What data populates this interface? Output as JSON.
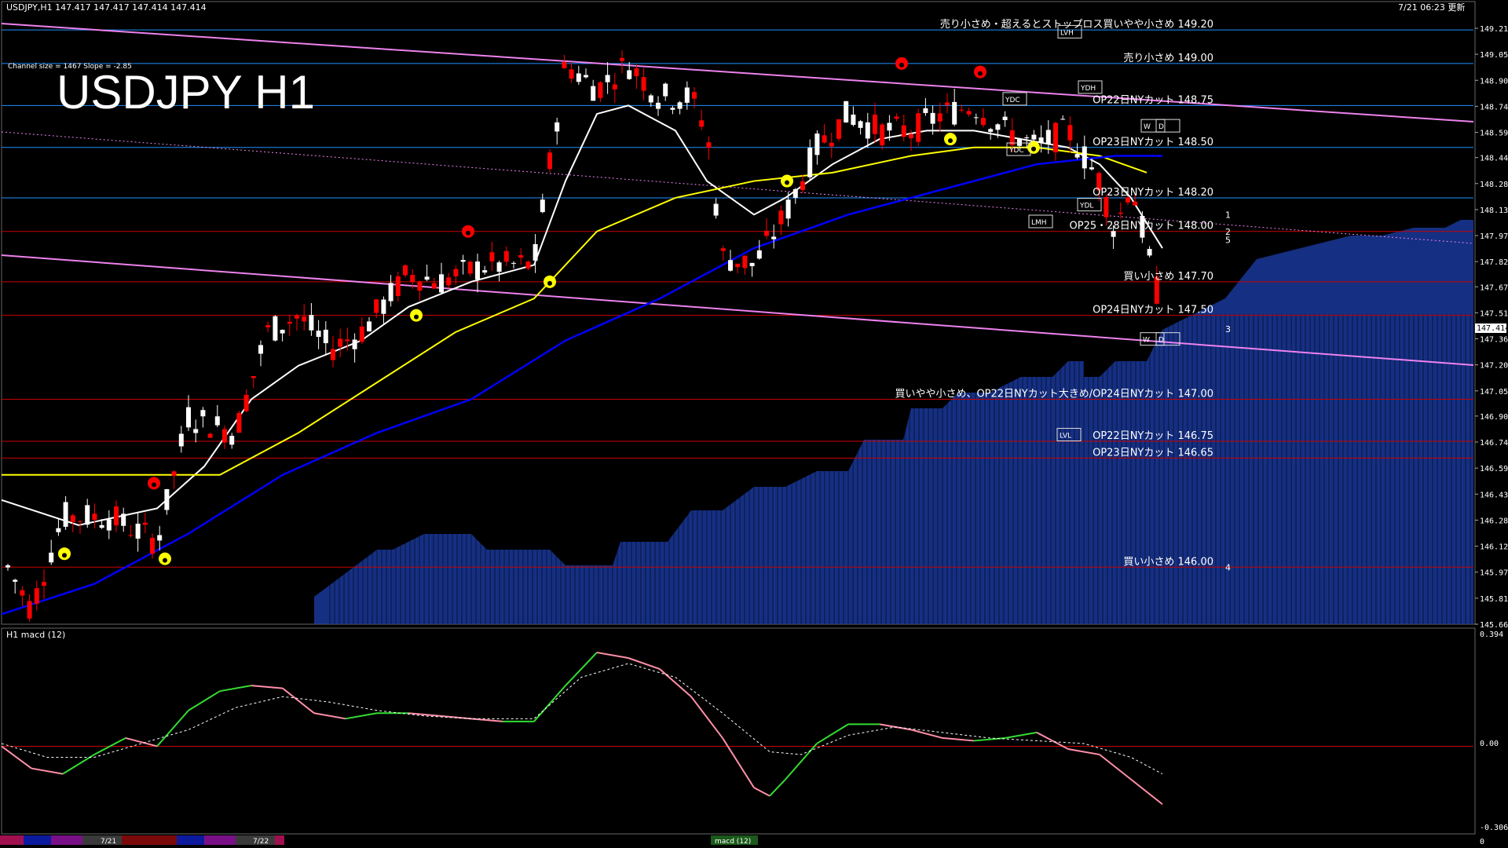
{
  "header": {
    "symbol_line": "USDJPY,H1  147.417 147.417 147.414 147.414",
    "channel_info": "Channel size = 1467 Slope = -2.85",
    "timestamp": "7/21 06:23 更新",
    "title": "USDJPY H1"
  },
  "macd_panel": {
    "label": "H1  macd (12)",
    "axis": [
      "0.394",
      "0.00",
      "-0.306",
      "0"
    ]
  },
  "bottom_bar": {
    "dates": [
      "7/21",
      "7/22"
    ],
    "indicator": "macd (12)"
  },
  "colors": {
    "bg": "#000000",
    "bull_candle": "#ffffff",
    "bear_candle": "#ff0000",
    "level_red": "#cc0000",
    "level_blue": "#1e90ff",
    "channel": "#ee82ee",
    "ma_white": "#ffffff",
    "ma_yellow": "#ffff00",
    "ma_blue": "#0000ff",
    "cloud": "#1c3fae",
    "macd_main_up": "#33dd33",
    "macd_main_down": "#ff8fa8",
    "macd_signal": "#ffffff"
  },
  "chart_data": {
    "type": "candlestick",
    "symbol": "USDJPY",
    "timeframe": "H1",
    "ylim": [
      145.66,
      149.21
    ],
    "y_ticks": [
      "149.210",
      "149.055",
      "148.900",
      "148.745",
      "148.590",
      "148.440",
      "148.285",
      "148.130",
      "147.975",
      "147.820",
      "147.670",
      "147.515",
      "147.360",
      "147.205",
      "147.050",
      "146.900",
      "146.745",
      "146.590",
      "146.435",
      "146.280",
      "146.125",
      "145.970",
      "145.815",
      "145.660"
    ],
    "current_price": "147.414",
    "levels": [
      {
        "label": "売り小さめ・超えるとストップロス買いやや小さめ 149.20",
        "price": 149.2,
        "color": "blue"
      },
      {
        "label": "売り小さめ 149.00",
        "price": 149.0,
        "color": "blue"
      },
      {
        "label": "OP22日NYカット 148.75",
        "price": 148.75,
        "color": "blue"
      },
      {
        "label": "OP23日NYカット 148.50",
        "price": 148.5,
        "color": "blue"
      },
      {
        "label": "OP23日NYカット 148.20",
        "price": 148.2,
        "color": "blue"
      },
      {
        "label": "OP25・28日NYカット 148.00",
        "price": 148.0,
        "color": "red"
      },
      {
        "label": "買い小さめ 147.70",
        "price": 147.7,
        "color": "red"
      },
      {
        "label": "OP24日NYカット 147.50",
        "price": 147.5,
        "color": "red"
      },
      {
        "label": "買いやや小さめ、OP22日NYカット大きめ/OP24日NYカット 147.00",
        "price": 147.0,
        "color": "red"
      },
      {
        "label": "OP22日NYカット 146.75",
        "price": 146.75,
        "color": "red"
      },
      {
        "label": "OP23日NYカット 146.65",
        "price": 146.65,
        "color": "red"
      },
      {
        "label": "買い小さめ 146.00",
        "price": 146.0,
        "color": "red"
      }
    ],
    "box_labels": [
      "YDH",
      "YDL",
      "YDC",
      "YDC",
      "LVH",
      "LVL",
      "LMH",
      "W",
      "D",
      "W",
      "D"
    ],
    "wave_numbers": [
      "1",
      "2",
      "5",
      "3",
      "4"
    ]
  }
}
